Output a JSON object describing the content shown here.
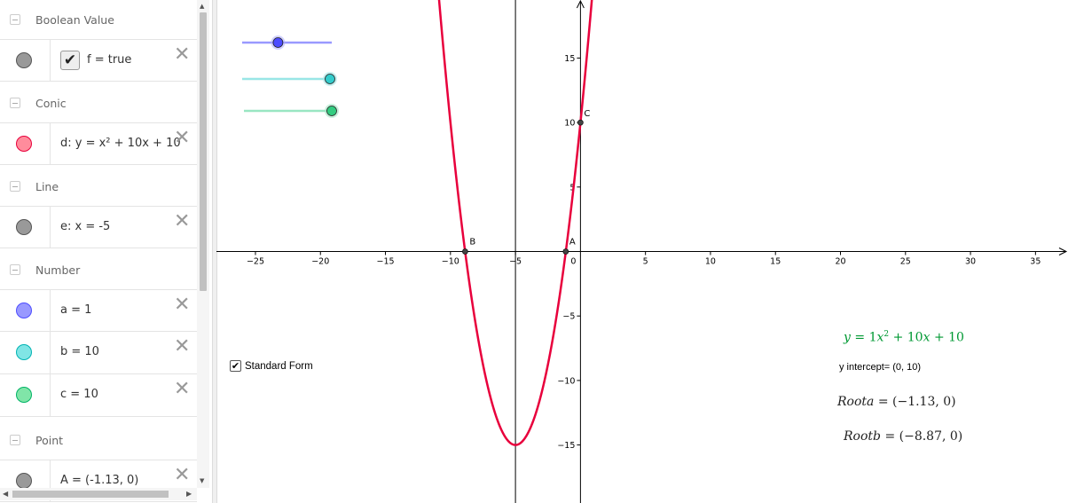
{
  "algebra": {
    "categories": {
      "boolean": "Boolean Value",
      "conic": "Conic",
      "line": "Line",
      "number": "Number",
      "point": "Point"
    },
    "items": {
      "f": {
        "definition": "f = true",
        "color": "#999999",
        "checked": true
      },
      "d": {
        "definition": "d: y = x² + 10x + 10",
        "color": "#ff8c9c"
      },
      "e": {
        "definition": "e: x = -5",
        "color": "#999999"
      },
      "a": {
        "definition": "a = 1",
        "color": "#9999ff"
      },
      "b": {
        "definition": "b = 10",
        "color": "#80e5e5"
      },
      "c": {
        "definition": "c = 10",
        "color": "#80e5a8"
      },
      "A": {
        "definition": "A = (-1.13, 0)",
        "color": "#999999"
      }
    },
    "delete_glyph": "✕",
    "check_glyph": "✔"
  },
  "graphics": {
    "checkbox_label": "Standard Form",
    "equation": {
      "y": "y",
      "eq": "=",
      "one": "1",
      "x1": "x",
      "sup": "2",
      "plus1": "+",
      "ten1": "10",
      "x2": "x",
      "plus2": "+",
      "ten2": "10"
    },
    "y_intercept": "y intercept= (0, 10)",
    "root_a": {
      "label": "Roota",
      "value": "= (−1.13, 0)"
    },
    "root_b": {
      "label": "Rootb",
      "value": "= (−8.87, 0)"
    },
    "colors": {
      "curve": "#e8003c",
      "slider_a": "#4d4dff",
      "slider_b": "#00b3b3",
      "slider_c": "#00b366",
      "equation": "#009933"
    }
  },
  "chart_data": {
    "type": "line",
    "function": "y = x^2 + 10x + 10",
    "coefficients": {
      "a": 1,
      "b": 10,
      "c": 10
    },
    "vertical_line": {
      "x": -5
    },
    "points": [
      {
        "name": "A",
        "x": -1.13,
        "y": 0
      },
      {
        "name": "B",
        "x": -8.87,
        "y": 0
      },
      {
        "name": "C",
        "x": 0,
        "y": 10
      }
    ],
    "vertex": {
      "x": -5,
      "y": -15
    },
    "xlim": [
      -28,
      37.5
    ],
    "ylim": [
      -19.5,
      19.5
    ],
    "x_ticks": [
      -25,
      -20,
      -15,
      -10,
      -5,
      0,
      5,
      10,
      15,
      20,
      25,
      30,
      35
    ],
    "y_ticks": [
      -15,
      -10,
      -5,
      5,
      10,
      15
    ],
    "x_tick_labels": [
      "−25",
      "−20",
      "−15",
      "−10",
      "−5",
      "0",
      "5",
      "10",
      "15",
      "20",
      "25",
      "30",
      "35"
    ],
    "y_tick_labels": [
      "−15",
      "−10",
      "−5",
      "5",
      "10",
      "15"
    ],
    "sliders": [
      {
        "name": "a",
        "value": 1,
        "fraction": 0.4
      },
      {
        "name": "b",
        "value": 10,
        "fraction": 0.98
      },
      {
        "name": "c",
        "value": 10,
        "fraction": 0.98
      }
    ],
    "grid": false
  }
}
